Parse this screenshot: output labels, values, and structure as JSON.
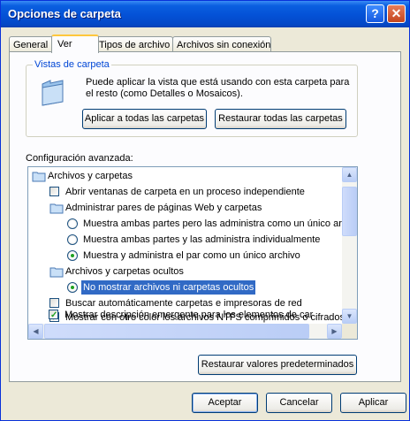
{
  "window": {
    "title": "Opciones de carpeta",
    "help_glyph": "?",
    "close_glyph": "✕"
  },
  "tabs": [
    {
      "label": "General",
      "active": false
    },
    {
      "label": "Ver",
      "active": true
    },
    {
      "label": "Tipos de archivo",
      "active": false
    },
    {
      "label": "Archivos sin conexión",
      "active": false
    }
  ],
  "views": {
    "group_label": "Vistas de carpeta",
    "description": "Puede aplicar la vista que está usando con esta carpeta para el resto (como Detalles o Mosaicos).",
    "apply_all": "Aplicar a todas las carpetas",
    "reset_all": "Restaurar todas las carpetas"
  },
  "advanced": {
    "label": "Configuración avanzada:",
    "items": [
      {
        "kind": "folder",
        "text": "Archivos y carpetas"
      },
      {
        "kind": "checkbox",
        "checked": false,
        "text": "Abrir ventanas de carpeta  en un proceso independiente"
      },
      {
        "kind": "folder",
        "text": "Administrar pares de páginas Web y carpetas"
      },
      {
        "kind": "radio",
        "checked": false,
        "text": "Muestra ambas partes pero las administra como un único archivo"
      },
      {
        "kind": "radio",
        "checked": false,
        "text": "Muestra ambas partes y las administra individualmente"
      },
      {
        "kind": "radio",
        "checked": true,
        "text": "Muestra y administra el par como un único archivo"
      },
      {
        "kind": "folder",
        "text": "Archivos y carpetas ocultos"
      },
      {
        "kind": "radio",
        "checked": true,
        "text": "No mostrar archivos ni carpetas ocultos",
        "selected": true
      },
      {
        "kind": "checkbox",
        "checked": false,
        "text": "Buscar automáticamente carpetas e impresoras de red"
      },
      {
        "kind": "checkbox",
        "checked": true,
        "text": "Mostrar con otro color los archivos NTFS comprimidos o cifrados"
      },
      {
        "kind": "checkbox",
        "checked": true,
        "text": "Mostrar descripción emergente para los elementos de carpeta y escritorio"
      }
    ],
    "restore_defaults": "Restaurar valores predeterminados"
  },
  "footer": {
    "ok": "Aceptar",
    "cancel": "Cancelar",
    "apply": "Aplicar"
  },
  "colors": {
    "titlebar": "#0451d6",
    "selection": "#316ac5",
    "group_label": "#0046d5"
  }
}
